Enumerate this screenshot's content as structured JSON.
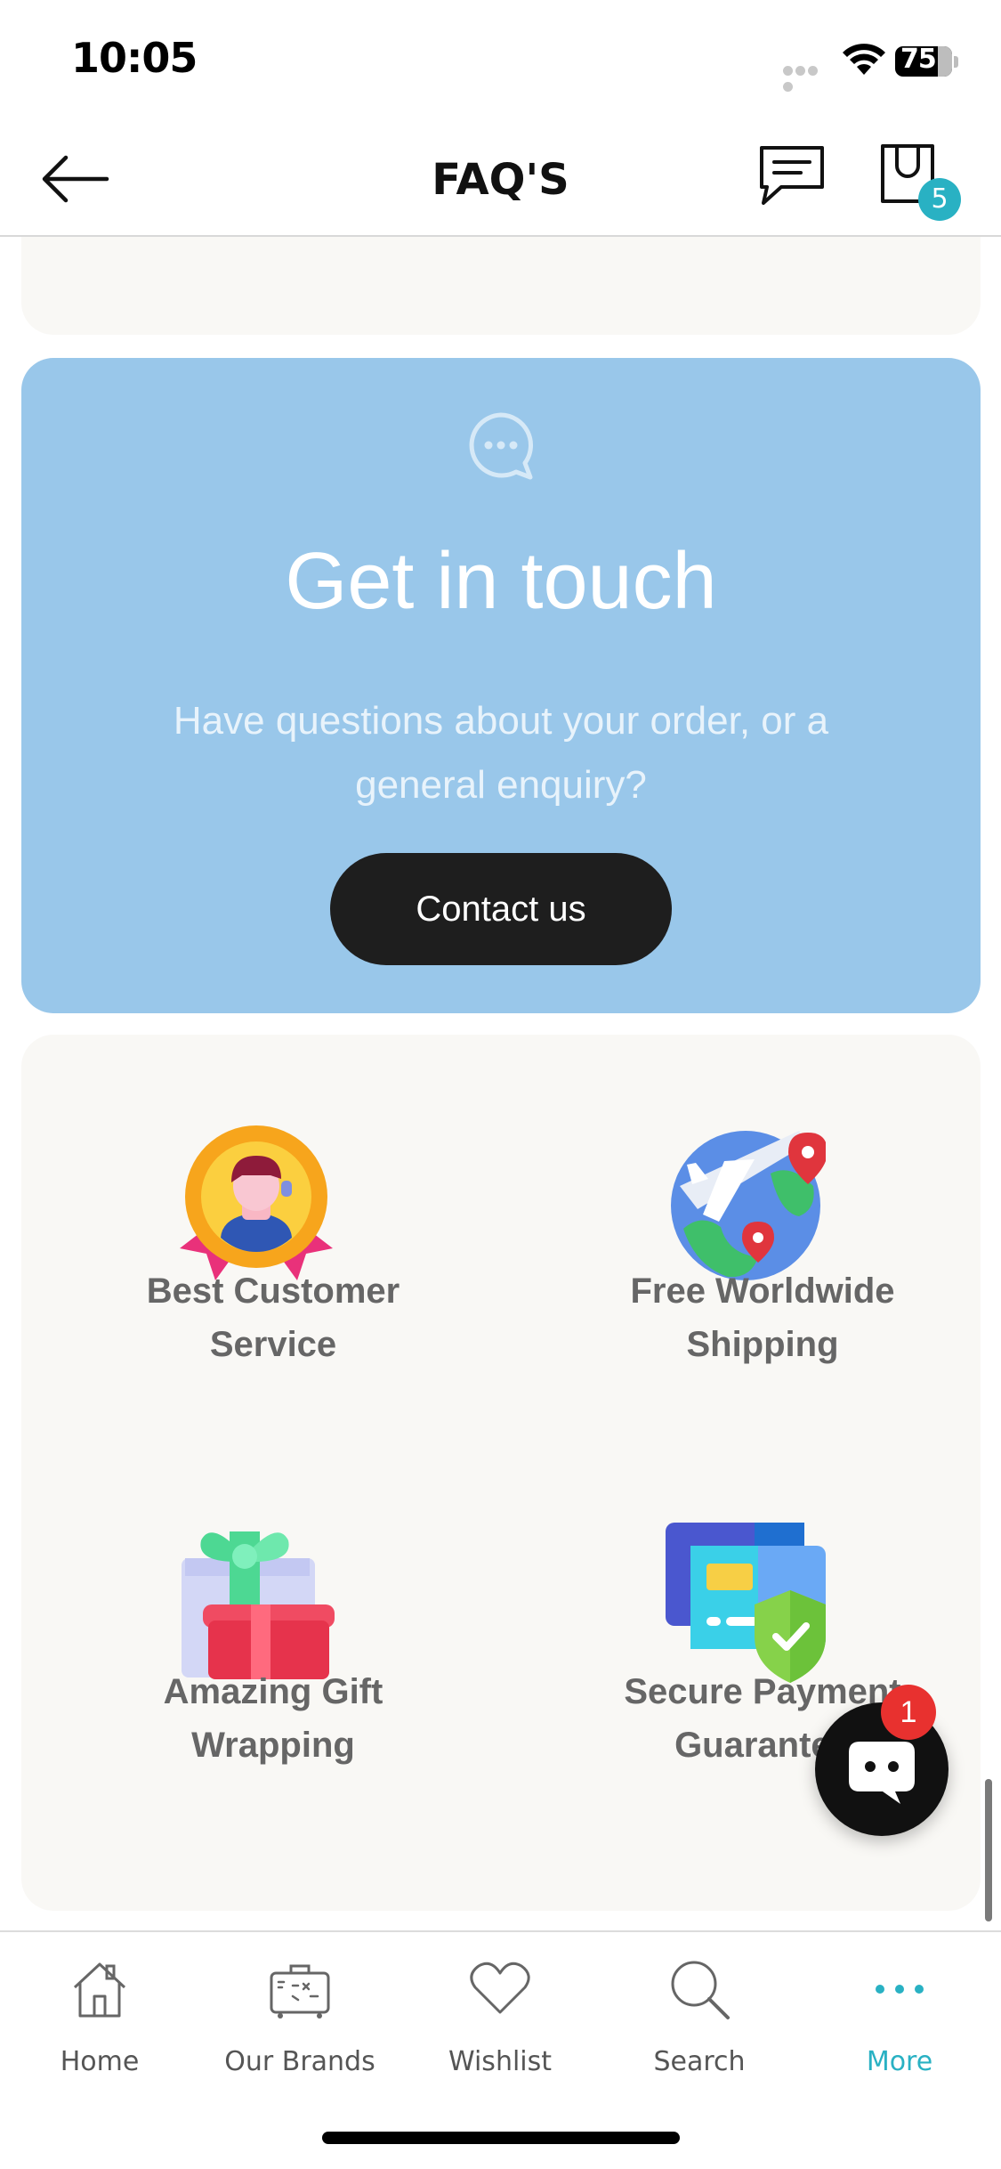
{
  "status_bar": {
    "time": "10:05",
    "battery": "75"
  },
  "header": {
    "title": "FAQ'S",
    "cart_count": "5",
    "icons": [
      "arrow-left-icon",
      "message-icon",
      "shopping-bag-icon"
    ]
  },
  "contact": {
    "title": "Get in touch",
    "subtitle": "Have questions about your order, or a general enquiry?",
    "button_label": "Contact us",
    "icon": "chat-bubble-icon",
    "background": "#99c7ea"
  },
  "features": [
    {
      "label": "Best Customer Service",
      "icon": "award-medal-icon"
    },
    {
      "label": "Free Worldwide Shipping",
      "icon": "globe-plane-icon"
    },
    {
      "label": "Amazing Gift Wrapping",
      "icon": "gift-box-icon"
    },
    {
      "label": "Secure Payment Guarantee",
      "icon": "secure-card-shield-icon"
    }
  ],
  "chat_widget": {
    "unread_count": "1"
  },
  "tabbar": {
    "active_color": "#29b1c3",
    "items": [
      {
        "label": "Home",
        "icon": "home-icon"
      },
      {
        "label": "Our Brands",
        "icon": "suitcase-icon"
      },
      {
        "label": "Wishlist",
        "icon": "heart-icon"
      },
      {
        "label": "Search",
        "icon": "search-icon"
      },
      {
        "label": "More",
        "icon": "more-dots-icon"
      }
    ]
  }
}
